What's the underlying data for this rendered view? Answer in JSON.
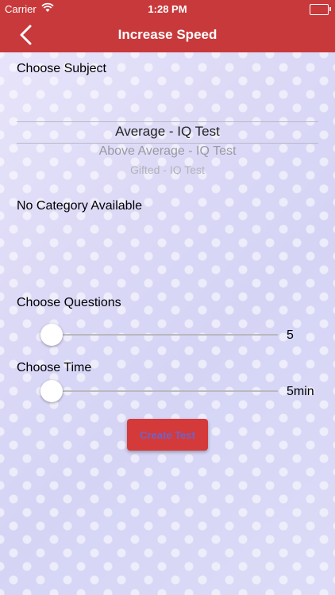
{
  "status_bar": {
    "carrier": "Carrier",
    "time": "1:28 PM"
  },
  "nav": {
    "title": "Increase Speed"
  },
  "subject": {
    "label": "Choose Subject",
    "options": [
      "Average - IQ Test",
      "Above Average - IQ Test",
      "Gifted - IQ Test"
    ],
    "selected": "Average - IQ Test"
  },
  "category": {
    "label": "No Category Available"
  },
  "questions": {
    "label": "Choose Questions",
    "value": "5"
  },
  "time_setting": {
    "label": "Choose Time",
    "value": "5min"
  },
  "create_button": {
    "label": "Create Test"
  },
  "colors": {
    "accent": "#c8393b",
    "button": "#d43a3a",
    "button_text": "#6e63c8"
  },
  "icons": {
    "back": "chevron-left-icon",
    "wifi": "wifi-icon",
    "battery": "battery-icon"
  }
}
